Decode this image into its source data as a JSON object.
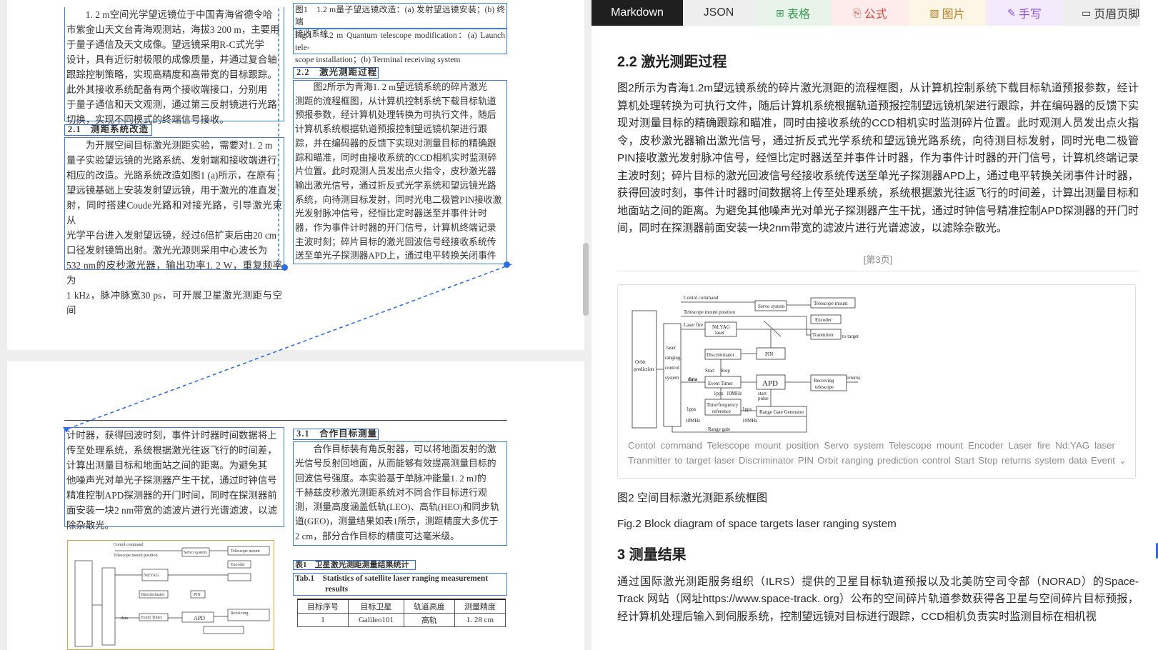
{
  "pdf": {
    "col1_top": [
      "1. 2 m空间光学望远镜位于中国青海省德令哈",
      "市紫金山天文台青海观测站，海拔3 200 m，主要用",
      "于量子通信及天文成像。望远镜采用R-C式光学",
      "设计，具有近衍射极限的成像质量，并通过复合轴",
      "跟踪控制策略，实现高精度和高带宽的目标跟踪。",
      "此外其接收系统配备有两个接收端接口，分别用",
      "于量子通信和天文观测，通过第三反射镜进行光路",
      "切换，实现不同模式的终端信号接收。"
    ],
    "heading_2_1": "2.1　测距系统改造",
    "col1_mid": [
      "为开展空间目标激光测距实验，需要对1. 2 m",
      "量子实验望远镜的光路系统、发射端和接收端进行",
      "相应的改造。光路系统改造如图1 (a)所示，在原有",
      "望远镜基础上安装发射望远镜，用于激光的准直发",
      "射，同时搭建Coude光路和对接光路，引导激光束从",
      "光学平台进入发射望远镜，经过6倍扩束后由20 cm",
      "口径发射镜筒出射。激光光源则采用中心波长为",
      "532 nm的皮秒激光器，输出功率1. 2 W，重复频率为",
      "1 kHz，脉冲脉宽30 ps，可开展卫星激光测距与空间"
    ],
    "fig1_cap_cn": [
      "图1　1.2 m量子望远镜改造：(a) 发射望远镜安装；(b) 终端",
      "接收系统"
    ],
    "fig1_cap_en": [
      "Fig.1　1.2 m Quantum telescope modification：(a) Launch tele-",
      "scope installation；(b) Terminal receiving system"
    ],
    "heading_2_2": "2.2　激光测距过程",
    "col2_mid": [
      "图2所示为青海1. 2 m望远镜系统的碎片激光",
      "测距的流程框图，从计算机控制系统下载目标轨道",
      "预报参数，经计算机处理转换为可执行文件，随后",
      "计算机系统根据轨道预报控制望远镜机架进行跟",
      "踪，并在编码器的反馈下实现对测量目标的精确跟",
      "踪和瞄准，同时由接收系统的CCD相机实时监测碎",
      "片位置。此时观测人员发出点火指令，皮秒激光器",
      "输出激光信号，通过折反式光学系统和望远镜光路",
      "系统，向待测目标发射，同时光电二极管PIN接收激",
      "光发射脉冲信号，经恒比定时器送至并事件计时",
      "器，作为事件计时器的开门信号，计算机终端记录",
      "主波时刻；碎片目标的激光回波信号经接收系统传",
      "送至单光子探测器APD上，通过电平转换关闭事件"
    ],
    "col1_bot": [
      "计时器，获得回波时刻，事件计时器时间数据将上",
      "传至处理系统，系统根据激光往返飞行的时间差，",
      "计算出测量目标和地面站之间的距离。为避免其",
      "他噪声光对单光子探测器产生干扰，通过时钟信号",
      "精准控制APD探测器的开门时间，同时在探测器前",
      "面安装一块2 nm带宽的滤波片进行光谱滤波，以滤",
      "除杂散光。"
    ],
    "heading_3_1": "3.1　合作目标测量",
    "col2_bot": [
      "合作目标装有角反射器，可以将地面发射的激",
      "光信号反射回地面，从而能够有效提高测量目标的",
      "回波信号强度。本实验基于单脉冲能量1. 2 mJ的",
      "千赫兹皮秒激光测距系统对不同合作目标进行观",
      "测，测量高度涵盖低轨(LEO)、高轨(HEO)和同步轨",
      "道(GEO)，测量结果如表1所示，测距精度大多优于",
      "2 cm，部分合作目标的精度可达毫米级。"
    ],
    "table1_cap_cn": "表1　卫星激光测距测量结果统计",
    "table1_cap_en": [
      "Tab.1　Statistics of satellite laser ranging measurement",
      "results"
    ],
    "table1_headers": [
      "目标序号",
      "目标卫星",
      "轨道高度",
      "测量精度"
    ],
    "table1_row1": [
      "1",
      "Galileo101",
      "高轨",
      "1. 28 cm"
    ]
  },
  "tabs": [
    {
      "label": "Markdown",
      "icon": ""
    },
    {
      "label": "JSON",
      "icon": ""
    },
    {
      "label": "表格",
      "icon": "⊞"
    },
    {
      "label": "公式",
      "icon": "⎘"
    },
    {
      "label": "图片",
      "icon": "▨"
    },
    {
      "label": "手写",
      "icon": "✎"
    },
    {
      "label": "页眉页脚",
      "icon": "▭"
    }
  ],
  "colors": {
    "accent": "#2d6fe0",
    "tab_active_bg": "#1f1f1f",
    "fig_highlight": "#d9a23a"
  },
  "result": {
    "section_title": "2.2 激光测距过程",
    "paragraph": "图2所示为青海1.2m望远镜系统的碎片激光测距的流程框图，从计算机控制系统下载目标轨道预报参数，经计算机处理转换为可执行文件，随后计算机系统根据轨道预报控制望远镜机架进行跟踪，并在编码器的反馈下实现对测量目标的精确跟踪和瞄准，同时由接收系统的CCD相机实时监测碎片位置。此时观测人员发出点火指令，皮秒激光器输出激光信号，通过折反式光学系统和望远镜光路系统，向待测目标发射，同时光电二极管PIN接收激光发射脉冲信号，经恒比定时器送至并事件计时器，作为事件计时器的开门信号，计算机终端记录主波时刻；碎片目标的激光回波信号经接收系统传送至单光子探测器APD上，通过电平转换关闭事件计时器，获得回波时刻，事件计时器时间数据将上传至处理系统，系统根据激光往返飞行的时间差，计算出测量目标和地面站之间的距离。为避免其他噪声光对单光子探测器产生干扰，通过时钟信号精准控制APD探测器的开门时间，同时在探测器前面安装一块2nm带宽的滤波片进行光谱滤波，以滤除杂散光。",
    "page_marker": "[第3页]",
    "figure_alt": "Contol command Telescope mount position Servo system Telescope mount Encoder Laser fire Nd:YAG laser Tranmitter to target laser Discriminator PIN Orbit ranging prediction control Start Stop returns system data Event Time ...",
    "caption_cn": "图2 空间目标激光测距系统框图",
    "caption_en": "Fig.2 Block diagram of space targets laser ranging system",
    "section3_title": "3 测量结果",
    "section3_text": "通过国际激光测距服务组织（ILRS）提供的卫星目标轨道预报以及北美防空司令部（NORAD）的Space-Track 网站（网址https://www.space-track. org）公布的空间碎片轨道参数获得各卫星与空间碎片目标预报，经计算机处理后输入到伺服系统，控制望远镜对目标进行跟踪，CCD相机负责实时监测目标在相机视"
  },
  "diagram": {
    "contol_command": "Contol command",
    "telescope_mount_position": "Telescope mount position",
    "servo_system": "Servo system",
    "telescope_mount": "Telescope mount",
    "encoder": "Encoder",
    "laser_fire": "Laser fire",
    "ndyag": "Nd:YAG",
    "laser": "laser",
    "tranmitter": "Tranmitter",
    "to_target": "to target",
    "discriminator": "Discriminator",
    "pin": "PIN",
    "orbit": "Orbit",
    "prediction": "prediction",
    "ranging_lines": [
      "laser",
      "ranging",
      "control",
      "system"
    ],
    "start": "Start",
    "stop": "Stop",
    "data": "data",
    "event_timer": "Event Timer",
    "apd": "APD",
    "receiving": "Receiving",
    "telescope": "telescope",
    "returns": "returns",
    "pps1": "1pps",
    "mhz10": "10MHz",
    "start_pulse_1": "start",
    "start_pulse_2": "pulse",
    "time_freq_1": "Time/frequency",
    "time_freq_2": "reference",
    "range_gate_generator": "Range Gate Generator",
    "range_gate": "Range gate"
  }
}
